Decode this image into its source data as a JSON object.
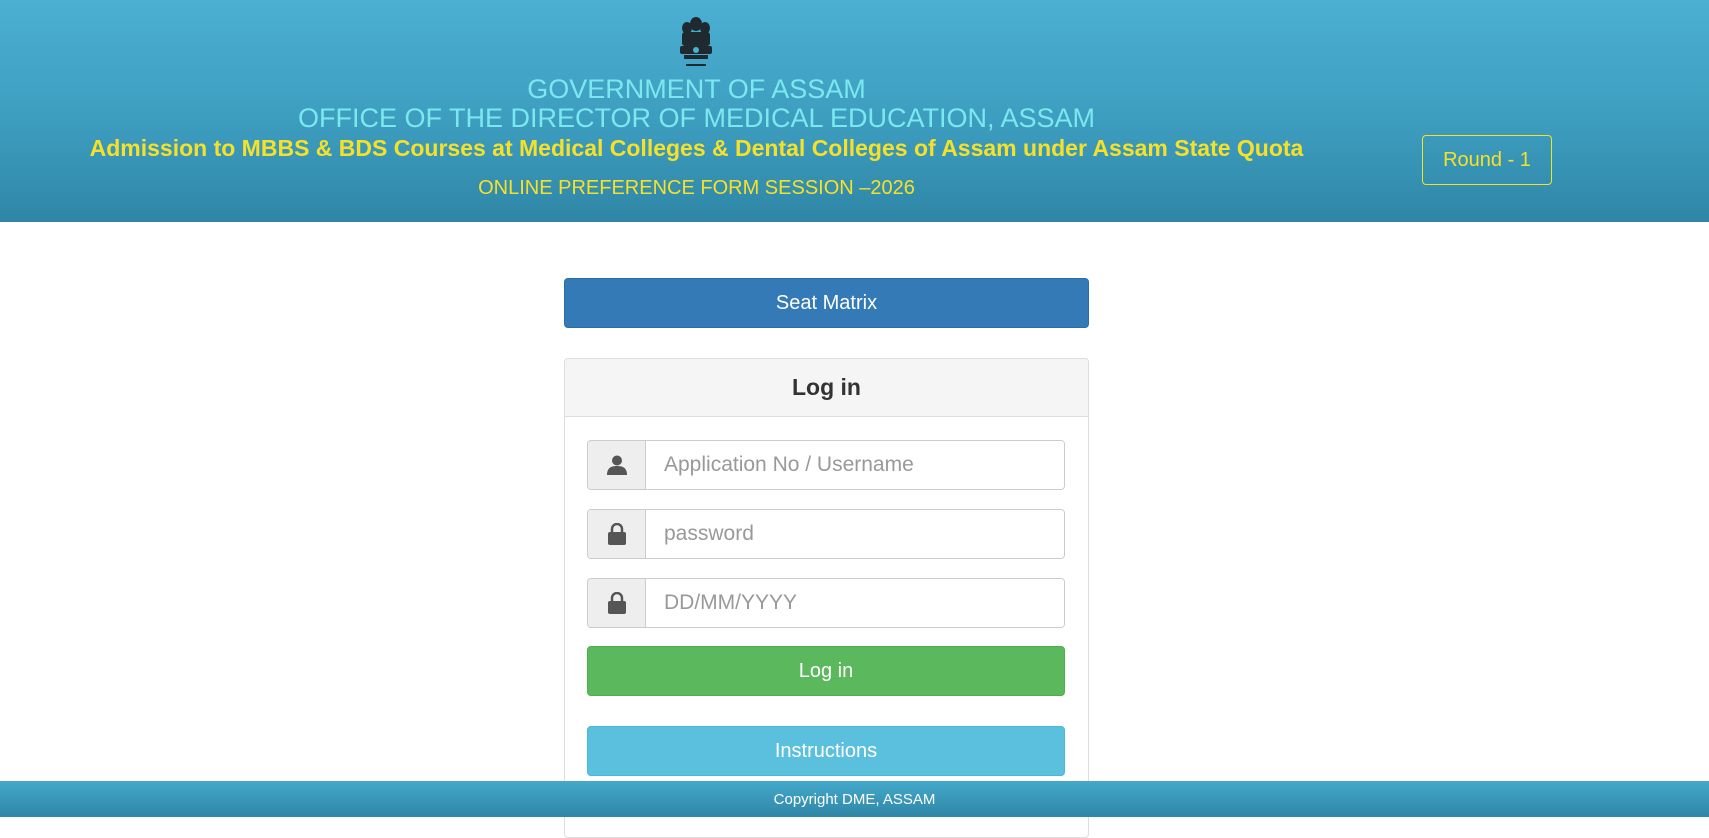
{
  "header": {
    "government": "GOVERNMENT OF ASSAM",
    "office": "OFFICE OF THE DIRECTOR OF MEDICAL EDUCATION, ASSAM",
    "admission": "Admission to MBBS & BDS Courses at Medical Colleges & Dental Colleges of Assam under Assam State Quota",
    "session": "ONLINE PREFERENCE FORM SESSION –2026",
    "round": "Round - 1",
    "emblem_icon": "state-emblem-icon"
  },
  "main": {
    "seat_matrix_label": "Seat Matrix",
    "login_panel": {
      "title": "Log in",
      "username": {
        "placeholder": "Application No / Username",
        "value": "",
        "icon": "user-icon"
      },
      "password": {
        "placeholder": "password",
        "value": "",
        "icon": "lock-icon"
      },
      "dob": {
        "placeholder": "DD/MM/YYYY",
        "value": "",
        "icon": "lock-icon"
      },
      "login_label": "Log in",
      "instructions_label": "Instructions"
    }
  },
  "footer": {
    "copyright": "Copyright DME, ASSAM"
  },
  "colors": {
    "header_top": "#4bb0d2",
    "header_bottom": "#2f86a6",
    "title_cyan": "#7ae8ee",
    "title_yellow": "#f6e12a",
    "primary_blue": "#337ab7",
    "success_green": "#5cb85c",
    "info_blue": "#5bc0de"
  }
}
